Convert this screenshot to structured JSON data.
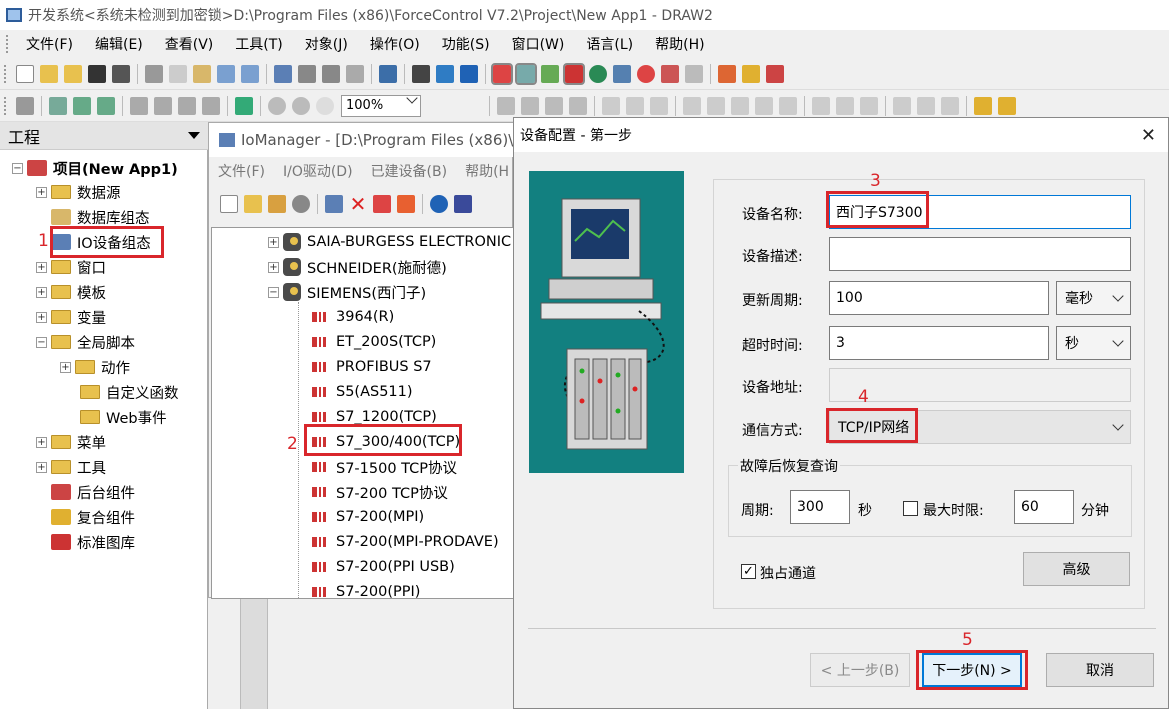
{
  "window": {
    "title": "开发系统<系统未检测到加密锁>D:\\Program Files (x86)\\ForceControl V7.2\\Project\\New App1 - DRAW2"
  },
  "menubar": [
    "文件(F)",
    "编辑(E)",
    "查看(V)",
    "工具(T)",
    "对象(J)",
    "操作(O)",
    "功能(S)",
    "窗口(W)",
    "语言(L)",
    "帮助(H)"
  ],
  "toolbar": {
    "zoom": "100%"
  },
  "project": {
    "header": "工程",
    "root": "项目(New App1)",
    "items": [
      "数据源",
      "数据库组态",
      "IO设备组态",
      "窗口",
      "模板",
      "变量",
      "全局脚本",
      "动作",
      "自定义函数",
      "Web事件",
      "菜单",
      "工具",
      "后台组件",
      "复合组件",
      "标准图库"
    ]
  },
  "iomanager": {
    "title": "IoManager - [D:\\Program Files (x86)\\F",
    "menu": [
      "文件(F)",
      "I/O驱动(D)",
      "已建设备(B)",
      "帮助(H"
    ],
    "vendors": [
      "SAIA-BURGESS ELECTRONIC",
      "SCHNEIDER(施耐德)",
      "SIEMENS(西门子)"
    ],
    "drivers": [
      "3964(R)",
      "ET_200S(TCP)",
      "PROFIBUS S7",
      "S5(AS511)",
      "S7_1200(TCP)",
      "S7_300/400(TCP)",
      "S7-1500 TCP协议",
      "S7-200 TCP协议",
      "S7-200(MPI)",
      "S7-200(MPI-PRODAVE)",
      "S7-200(PPI USB)",
      "S7-200(PPI)"
    ]
  },
  "dialog": {
    "title": "设备配置 - 第一步",
    "close": "✕",
    "name_label": "设备名称:",
    "name_value": "西门子S7300",
    "desc_label": "设备描述:",
    "desc_value": "",
    "period_label": "更新周期:",
    "period_value": "100",
    "period_unit": "毫秒",
    "timeout_label": "超时时间:",
    "timeout_value": "3",
    "timeout_unit": "秒",
    "addr_label": "设备地址:",
    "addr_value": "",
    "comm_label": "通信方式:",
    "comm_value": "TCP/IP网络",
    "recover_legend": "故障后恢复查询",
    "cycle_label": "周期:",
    "cycle_value": "300",
    "cycle_unit": "秒",
    "maxlimit_label": "最大时限:",
    "maxlimit_value": "60",
    "maxlimit_unit": "分钟",
    "exclusive_label": "独占通道",
    "advanced": "高级",
    "prev": "< 上一步(B)",
    "next": "下一步(N) >",
    "cancel": "取消"
  },
  "steps": [
    "1",
    "2",
    "3",
    "4",
    "5"
  ]
}
